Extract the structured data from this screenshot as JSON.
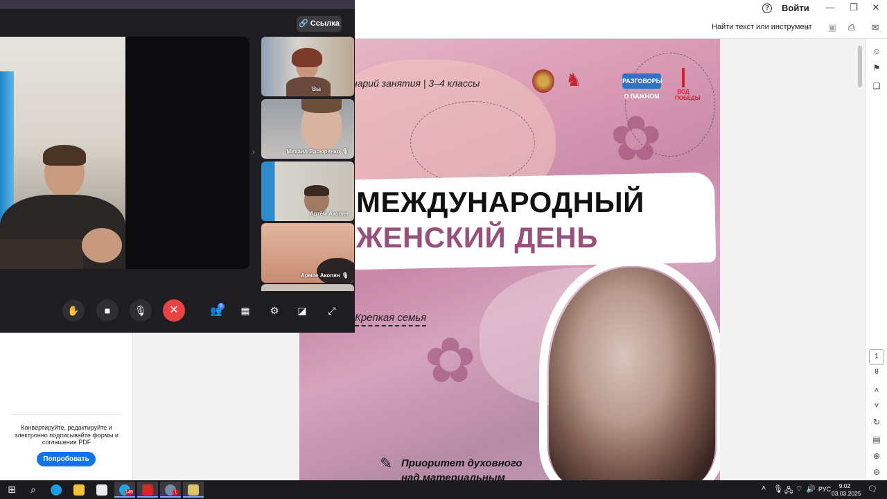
{
  "reader": {
    "signin_label": "Войти",
    "find_label": "Найти текст или инструмент",
    "promo_text": "Конвертируйте, редактируйте и электронно подписывайте формы и соглашения PDF",
    "promo_button": "Попробовать",
    "current_page": "1",
    "total_pages": "8"
  },
  "pdf": {
    "header_text": "нарий занятия | 3–4 классы",
    "logo3_text": "РАЗГОВОРЫ О ВАЖНОМ",
    "logo4_text": "ВОД ПОБЕДЫ",
    "title_line1": "МЕЖДУНАРОДНЫЙ",
    "title_line2": "ЖЕНСКИЙ ДЕНЬ",
    "subtitle": "Крепкая семья",
    "bottom_line1": "Приоритет духовного",
    "bottom_line2": "над материальным"
  },
  "call": {
    "link_button": "Ссылка",
    "participants": [
      {
        "name": "Вы"
      },
      {
        "name": "Михаил Васюренко"
      },
      {
        "name": "Артём Акопян"
      },
      {
        "name": "Армее Акопян"
      }
    ],
    "participants_badge": "6"
  },
  "taskbar": {
    "language": "РУС",
    "time": "9:02",
    "date": "03.03.2025",
    "telegram_badge": "146",
    "yandex_badge": "1"
  }
}
